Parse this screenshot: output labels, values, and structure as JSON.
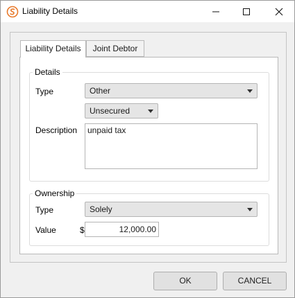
{
  "window": {
    "title": "Liability Details",
    "accent_color": "#e8792b"
  },
  "tabs": [
    {
      "label": "Liability Details",
      "active": true
    },
    {
      "label": "Joint Debtor",
      "active": false
    }
  ],
  "details": {
    "group_title": "Details",
    "type_label": "Type",
    "type_value": "Other",
    "security_value": "Unsecured",
    "description_label": "Description",
    "description_value": "unpaid tax"
  },
  "ownership": {
    "group_title": "Ownership",
    "type_label": "Type",
    "type_value": "Solely",
    "value_label": "Value",
    "currency_symbol": "$",
    "value": "12,000.00"
  },
  "buttons": {
    "ok_label": "OK",
    "cancel_label": "CANCEL"
  }
}
